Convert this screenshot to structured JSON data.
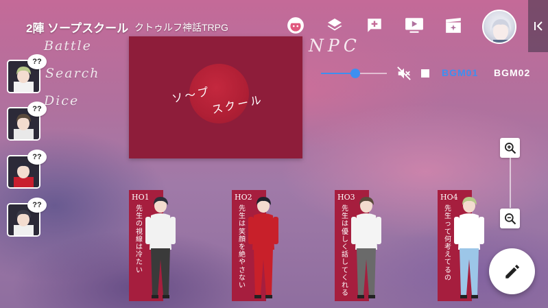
{
  "room": {
    "name": "2陣 ソープスクール",
    "system": "クトゥルフ神話TRPG"
  },
  "toolbar": {
    "icons": [
      "face-icon",
      "layers-icon",
      "add-chat-icon",
      "play-screen-icon",
      "movie-effect-icon"
    ],
    "collapse_icon": "collapse-left-icon"
  },
  "menu": {
    "battle": "Battle",
    "search": "Search",
    "dice": "Dice",
    "npc": "NPC"
  },
  "party": [
    {
      "status": "??",
      "hair": "#b7c98a",
      "coat": "#f2f2f2"
    },
    {
      "status": "??",
      "hair": "#5a4a3c",
      "coat": "#e9e9e9"
    },
    {
      "status": "??",
      "hair": "#2a2a3a",
      "coat": "#c81e2e"
    },
    {
      "status": "??",
      "hair": "#3a3a48",
      "coat": "#f0f0f0"
    }
  ],
  "title_card": {
    "line1": "ソ～プ",
    "line2": "スクール",
    "bg": "#8e1d3a"
  },
  "bgm": {
    "volume": 0.52,
    "tabs": [
      {
        "label": "BGM01",
        "active": true
      },
      {
        "label": "BGM02",
        "active": false
      }
    ],
    "active_color": "#3d8ff0"
  },
  "ho_cards": [
    {
      "label": "HO1",
      "text": "先生の視線は冷たい",
      "hair": "#2c2f3a",
      "top": "#f2f2f2",
      "bottom": "#3a3a3a"
    },
    {
      "label": "HO2",
      "text": "先生は笑顔を絶やさない",
      "hair": "#20222c",
      "top": "#c8202a",
      "bottom": "#c8202a"
    },
    {
      "label": "HO3",
      "text": "先生は優しく話してくれる",
      "hair": "#5a4a3c",
      "top": "#f4f4f4",
      "bottom": "#6a6a6a"
    },
    {
      "label": "HO4",
      "text": "先生って何考えてるの",
      "hair": "#b7c98a",
      "top": "#ffffff",
      "bottom": "#9cc6e8"
    }
  ]
}
